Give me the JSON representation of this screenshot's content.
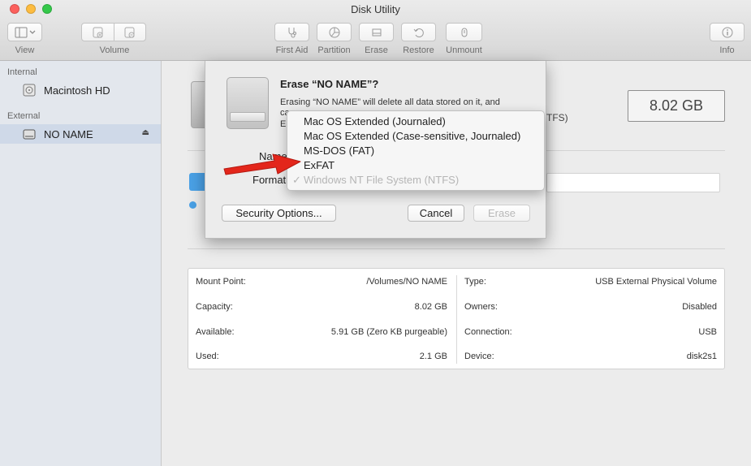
{
  "window": {
    "title": "Disk Utility"
  },
  "toolbar": {
    "view_label": "View",
    "volume_label": "Volume",
    "first_aid_label": "First Aid",
    "partition_label": "Partition",
    "erase_label": "Erase",
    "restore_label": "Restore",
    "unmount_label": "Unmount",
    "info_label": "Info",
    "icons": [
      "sidebar-toggle-icon",
      "add-volume-icon",
      "remove-volume-icon",
      "stethoscope-icon",
      "pie-chart-icon",
      "eraser-icon",
      "restore-icon",
      "eject-icon",
      "info-icon"
    ]
  },
  "sidebar": {
    "internal_header": "Internal",
    "external_header": "External",
    "items": [
      {
        "label": "Macintosh HD",
        "icon": "internal-disk-icon",
        "selected": false
      },
      {
        "label": "NO NAME",
        "icon": "external-disk-icon",
        "selected": true,
        "eject_glyph": "⏏"
      }
    ]
  },
  "main": {
    "capacity_badge": "8.02 GB",
    "format_fragment": "TFS)",
    "info": {
      "left": [
        {
          "key": "Mount Point:",
          "value": "/Volumes/NO NAME"
        },
        {
          "key": "Capacity:",
          "value": "8.02 GB"
        },
        {
          "key": "Available:",
          "value": "5.91 GB (Zero KB purgeable)"
        },
        {
          "key": "Used:",
          "value": "2.1 GB"
        }
      ],
      "right": [
        {
          "key": "Type:",
          "value": "USB External Physical Volume"
        },
        {
          "key": "Owners:",
          "value": "Disabled"
        },
        {
          "key": "Connection:",
          "value": "USB"
        },
        {
          "key": "Device:",
          "value": "disk2s1"
        }
      ]
    }
  },
  "dialog": {
    "title": "Erase “NO NAME”?",
    "desc_line1": "Erasing “NO NAME” will delete all data stored on it, and",
    "desc_line2": "ca",
    "desc_line3": "Er",
    "name_label": "Name",
    "format_label": "Format",
    "security_button": "Security Options...",
    "cancel_button": "Cancel",
    "erase_button": "Erase",
    "format_menu": [
      {
        "label": "Mac OS Extended (Journaled)",
        "enabled": true,
        "checked": false
      },
      {
        "label": "Mac OS Extended (Case-sensitive, Journaled)",
        "enabled": true,
        "checked": false
      },
      {
        "label": "MS-DOS (FAT)",
        "enabled": true,
        "checked": false
      },
      {
        "label": "ExFAT",
        "enabled": true,
        "checked": false
      },
      {
        "label": "Windows NT File System (NTFS)",
        "enabled": false,
        "checked": true
      }
    ],
    "check_glyph": "✓",
    "arrow_color": "#e3261b"
  }
}
